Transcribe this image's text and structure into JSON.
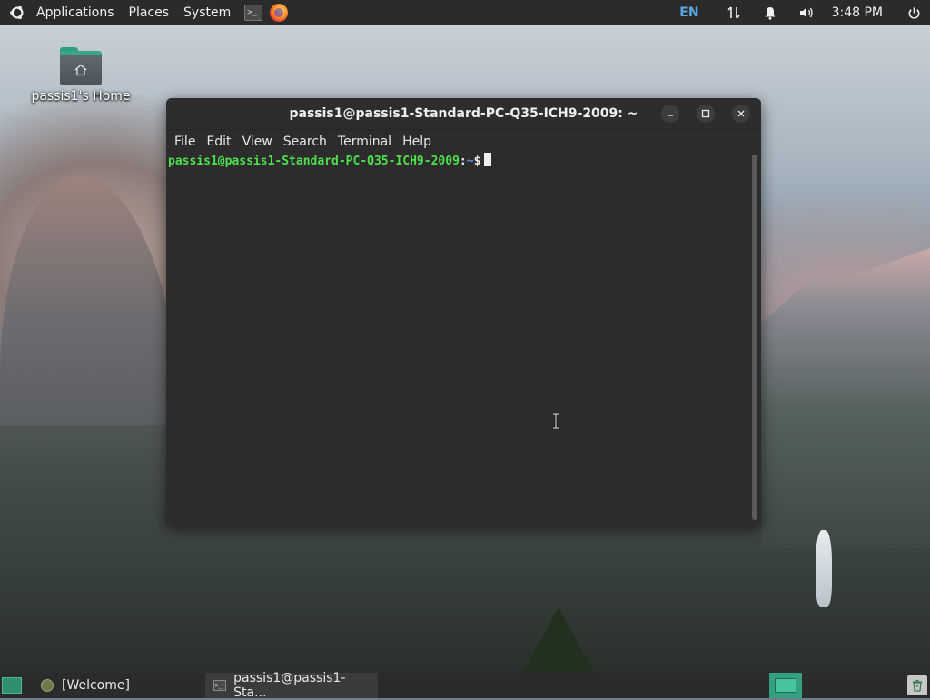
{
  "top_panel": {
    "menus": [
      "Applications",
      "Places",
      "System"
    ],
    "launchers": [
      "terminal-launcher",
      "firefox-launcher"
    ],
    "keyboard_layout": "EN",
    "clock": "3:48 PM"
  },
  "desktop": {
    "icons": [
      {
        "label": "passis1's Home",
        "icon": "home-folder-icon"
      }
    ]
  },
  "terminal_window": {
    "title": "passis1@passis1-Standard-PC-Q35-ICH9-2009: ~",
    "menu": [
      "File",
      "Edit",
      "View",
      "Search",
      "Terminal",
      "Help"
    ],
    "prompt": {
      "user_host": "passis1@passis1-Standard-PC-Q35-ICH9-2009",
      "separator": ":",
      "path": "~",
      "symbol": "$"
    }
  },
  "bottom_panel": {
    "tasks": [
      {
        "label": "[Welcome]",
        "icon": "welcome-icon"
      },
      {
        "label": "passis1@passis1-Sta...",
        "icon": "terminal-icon"
      }
    ]
  },
  "colors": {
    "panel_bg": "#2b2b2b",
    "terminal_bg": "#2c2c2c",
    "prompt_user": "#4ee04e",
    "prompt_path": "#5c9be6",
    "accent": "#34a081",
    "lang_indicator": "#5aa7e0"
  }
}
